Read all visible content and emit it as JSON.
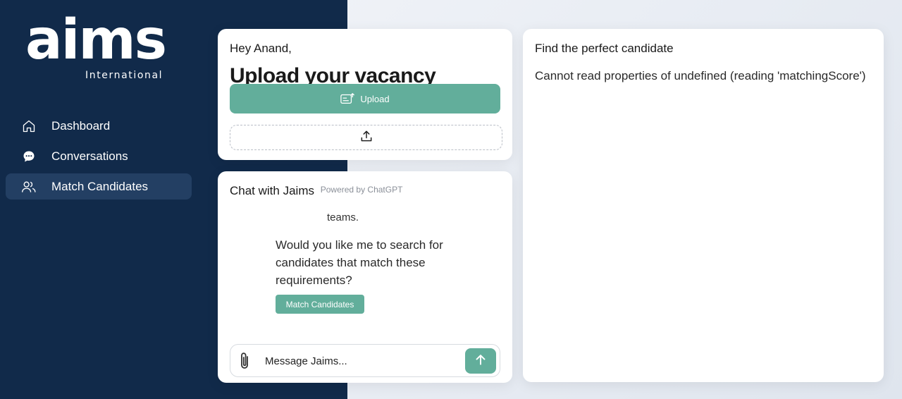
{
  "brand": {
    "logo_text": "aims",
    "logo_sub": "International"
  },
  "sidebar": {
    "items": [
      {
        "label": "Dashboard",
        "icon": "home-icon",
        "active": false
      },
      {
        "label": "Conversations",
        "icon": "chat-bubble-icon",
        "active": false
      },
      {
        "label": "Match Candidates",
        "icon": "users-icon",
        "active": true
      }
    ]
  },
  "upload": {
    "greeting": "Hey Anand,",
    "heading": "Upload your vacancy",
    "button_label": "Upload"
  },
  "chat": {
    "title": "Chat with Jaims",
    "powered_by": "Powered by ChatGPT",
    "message_fragment": "teams.",
    "message_body": "Would you like me to search for candidates that match these requirements?",
    "action_label": "Match Candidates",
    "input_placeholder": "Message Jaims..."
  },
  "results": {
    "title": "Find the perfect candidate",
    "error": "Cannot read properties of undefined (reading 'matchingScore')"
  },
  "colors": {
    "sidebar_bg": "#112a4a",
    "active_item_bg": "#233f63",
    "accent": "#62ae9b"
  }
}
